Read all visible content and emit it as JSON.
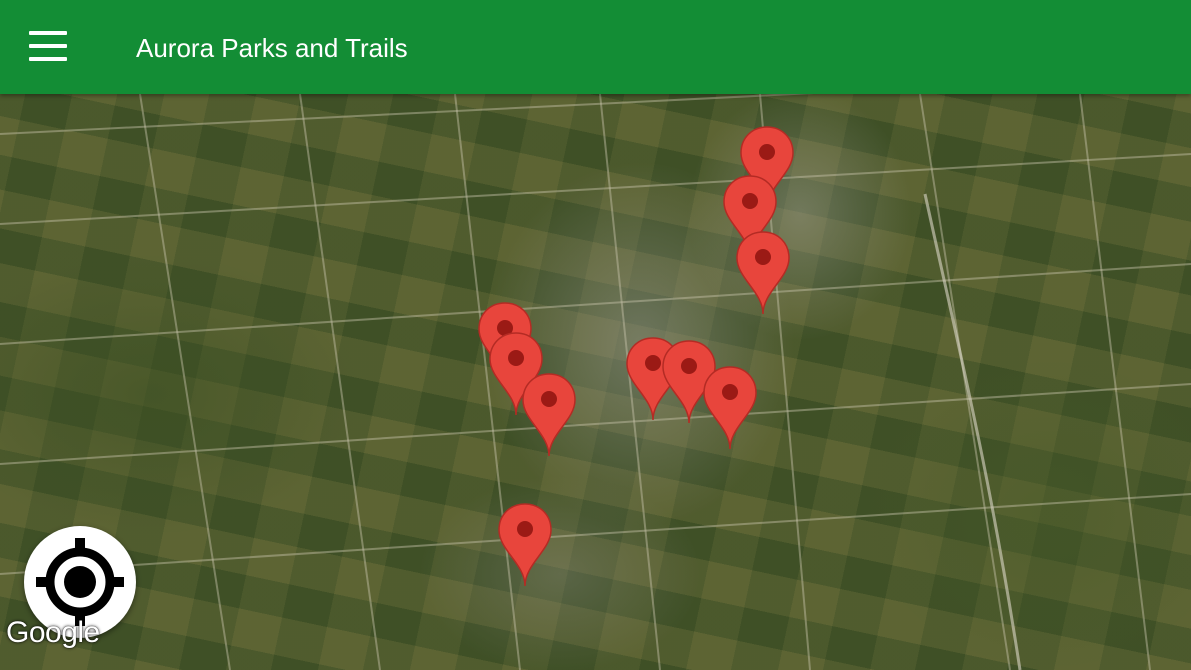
{
  "app_bar": {
    "title": "Aurora Parks and Trails",
    "color": "#138d35",
    "menu_icon": "hamburger-menu-icon"
  },
  "map": {
    "type": "satellite",
    "pin_color": "#e8453c",
    "pin_dot_color": "#9b1a15",
    "markers_count_visible": 10,
    "attribution": "Google"
  },
  "controls": {
    "my_location_icon": "crosshair-location-icon"
  }
}
